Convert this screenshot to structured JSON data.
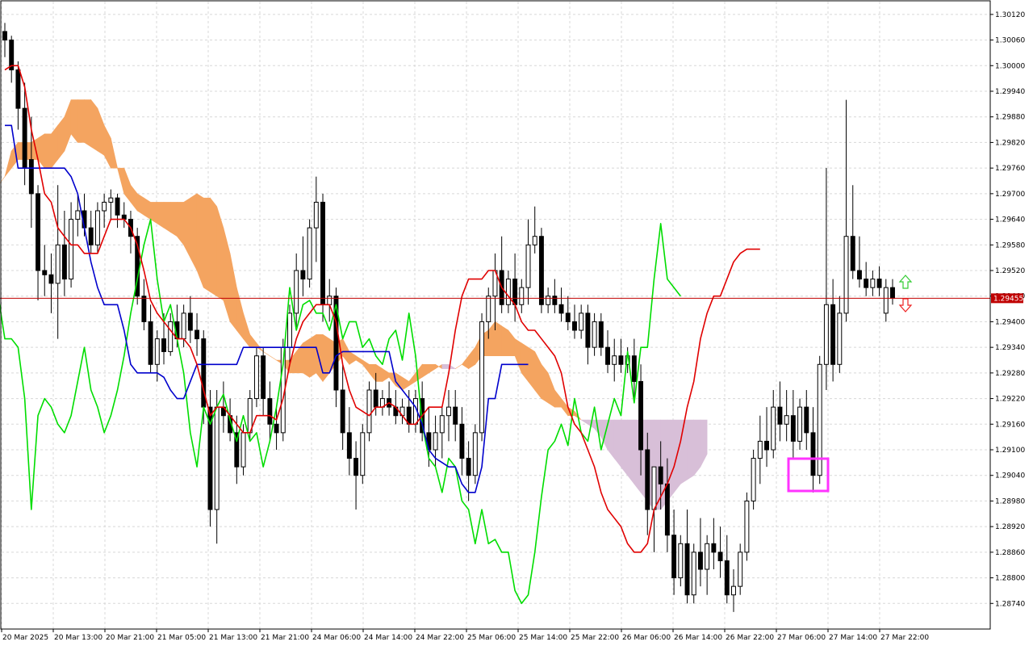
{
  "chart_data": {
    "type": "candlestick",
    "current_price": "1.29455",
    "ylim": [
      1.2868,
      1.3015
    ],
    "y_ticks": [
      "1.30120",
      "1.30060",
      "1.30000",
      "1.29940",
      "1.29880",
      "1.29820",
      "1.29760",
      "1.29700",
      "1.29640",
      "1.29580",
      "1.29520",
      "1.29460",
      "1.29400",
      "1.29340",
      "1.29280",
      "1.29220",
      "1.29160",
      "1.29100",
      "1.29040",
      "1.28980",
      "1.28920",
      "1.28860",
      "1.28800",
      "1.28740"
    ],
    "x_ticks": [
      "20 Mar 2025",
      "20 Mar 13:00",
      "20 Mar 21:00",
      "21 Mar 05:00",
      "21 Mar 13:00",
      "21 Mar 21:00",
      "24 Mar 06:00",
      "24 Mar 14:00",
      "24 Mar 22:00",
      "25 Mar 06:00",
      "25 Mar 14:00",
      "25 Mar 22:00",
      "26 Mar 06:00",
      "26 Mar 14:00",
      "26 Mar 22:00",
      "27 Mar 06:00",
      "27 Mar 14:00",
      "27 Mar 22:00"
    ],
    "colors": {
      "bull": "#ffffff",
      "bear": "#000000",
      "tenkan": "#e00000",
      "kijun": "#0000cc",
      "chikou": "#00dd00",
      "cloud_bull": "#f4a460",
      "cloud_bear": "#d8bfd8",
      "price_line": "#c00000",
      "highlight": "#ff33ff",
      "arrow_up": "#33cc33",
      "arrow_down": "#ee2222"
    },
    "candles": [
      [
        1.3008,
        1.301,
        1.3002,
        1.3006
      ],
      [
        1.3006,
        1.3007,
        1.2996,
        1.2999
      ],
      [
        1.2999,
        1.3001,
        1.2985,
        1.299
      ],
      [
        1.299,
        1.2996,
        1.2972,
        1.2976
      ],
      [
        1.2978,
        1.2988,
        1.2962,
        1.297
      ],
      [
        1.297,
        1.2972,
        1.2945,
        1.2952
      ],
      [
        1.2952,
        1.2958,
        1.2946,
        1.2951
      ],
      [
        1.2951,
        1.2956,
        1.2942,
        1.2949
      ],
      [
        1.2949,
        1.2972,
        1.2936,
        1.2958
      ],
      [
        1.2958,
        1.2966,
        1.2946,
        1.295
      ],
      [
        1.295,
        1.2968,
        1.2948,
        1.2964
      ],
      [
        1.2964,
        1.297,
        1.296,
        1.2966
      ],
      [
        1.2966,
        1.297,
        1.296,
        1.2962
      ],
      [
        1.2962,
        1.2966,
        1.2956,
        1.2958
      ],
      [
        1.2958,
        1.2968,
        1.2956,
        1.2966
      ],
      [
        1.2966,
        1.297,
        1.2962,
        1.2968
      ],
      [
        1.2968,
        1.2971,
        1.2964,
        1.2969
      ],
      [
        1.2969,
        1.297,
        1.2962,
        1.2965
      ],
      [
        1.2965,
        1.2968,
        1.2962,
        1.2964
      ],
      [
        1.2964,
        1.2966,
        1.2956,
        1.296
      ],
      [
        1.296,
        1.2962,
        1.2944,
        1.2946
      ],
      [
        1.2946,
        1.295,
        1.2938,
        1.294
      ],
      [
        1.294,
        1.2944,
        1.2928,
        1.293
      ],
      [
        1.293,
        1.2938,
        1.2926,
        1.2936
      ],
      [
        1.2936,
        1.2942,
        1.293,
        1.2933
      ],
      [
        1.2933,
        1.2942,
        1.2932,
        1.294
      ],
      [
        1.294,
        1.2944,
        1.2934,
        1.2936
      ],
      [
        1.2936,
        1.2944,
        1.2934,
        1.2942
      ],
      [
        1.2942,
        1.2946,
        1.2935,
        1.2938
      ],
      [
        1.2938,
        1.2942,
        1.2932,
        1.2936
      ],
      [
        1.2936,
        1.2938,
        1.2916,
        1.292
      ],
      [
        1.292,
        1.2924,
        1.2892,
        1.2896
      ],
      [
        1.2896,
        1.2924,
        1.2888,
        1.292
      ],
      [
        1.292,
        1.2926,
        1.2914,
        1.2918
      ],
      [
        1.2918,
        1.2922,
        1.2912,
        1.2914
      ],
      [
        1.2914,
        1.2918,
        1.2902,
        1.2906
      ],
      [
        1.2906,
        1.2916,
        1.2904,
        1.2914
      ],
      [
        1.2914,
        1.2924,
        1.2912,
        1.2922
      ],
      [
        1.2922,
        1.2934,
        1.292,
        1.2932
      ],
      [
        1.2932,
        1.2934,
        1.2918,
        1.2922
      ],
      [
        1.2922,
        1.2926,
        1.2912,
        1.2916
      ],
      [
        1.2916,
        1.292,
        1.291,
        1.2914
      ],
      [
        1.2914,
        1.2936,
        1.2912,
        1.2934
      ],
      [
        1.2934,
        1.2944,
        1.293,
        1.2942
      ],
      [
        1.2942,
        1.2956,
        1.2938,
        1.2952
      ],
      [
        1.2952,
        1.296,
        1.2946,
        1.295
      ],
      [
        1.295,
        1.2964,
        1.2948,
        1.2962
      ],
      [
        1.2962,
        1.2974,
        1.2954,
        1.2968
      ],
      [
        1.2968,
        1.297,
        1.294,
        1.2944
      ],
      [
        1.2944,
        1.295,
        1.294,
        1.2946
      ],
      [
        1.2946,
        1.2948,
        1.292,
        1.2924
      ],
      [
        1.2924,
        1.293,
        1.291,
        1.2914
      ],
      [
        1.2914,
        1.292,
        1.2904,
        1.2908
      ],
      [
        1.2908,
        1.2912,
        1.2896,
        1.2904
      ],
      [
        1.2904,
        1.2916,
        1.2902,
        1.2914
      ],
      [
        1.2914,
        1.2926,
        1.2912,
        1.2924
      ],
      [
        1.2924,
        1.2928,
        1.2918,
        1.292
      ],
      [
        1.292,
        1.2924,
        1.2918,
        1.2922
      ],
      [
        1.2922,
        1.2926,
        1.2918,
        1.292
      ],
      [
        1.292,
        1.2924,
        1.2916,
        1.2918
      ],
      [
        1.2918,
        1.2922,
        1.2916,
        1.292
      ],
      [
        1.292,
        1.2924,
        1.2914,
        1.2916
      ],
      [
        1.2916,
        1.2924,
        1.2914,
        1.2922
      ],
      [
        1.2922,
        1.2926,
        1.2912,
        1.2914
      ],
      [
        1.2914,
        1.292,
        1.2906,
        1.291
      ],
      [
        1.291,
        1.2918,
        1.2906,
        1.2914
      ],
      [
        1.2914,
        1.292,
        1.2908,
        1.2918
      ],
      [
        1.2918,
        1.2924,
        1.2912,
        1.292
      ],
      [
        1.292,
        1.2924,
        1.2912,
        1.2916
      ],
      [
        1.2916,
        1.292,
        1.2904,
        1.2908
      ],
      [
        1.2908,
        1.2912,
        1.2898,
        1.2904
      ],
      [
        1.2904,
        1.2916,
        1.2902,
        1.2914
      ],
      [
        1.2914,
        1.2942,
        1.2912,
        1.294
      ],
      [
        1.294,
        1.2948,
        1.2936,
        1.2946
      ],
      [
        1.2946,
        1.2956,
        1.2938,
        1.2952
      ],
      [
        1.2952,
        1.296,
        1.2942,
        1.2944
      ],
      [
        1.2944,
        1.2952,
        1.2942,
        1.295
      ],
      [
        1.295,
        1.2956,
        1.294,
        1.2944
      ],
      [
        1.2944,
        1.295,
        1.2942,
        1.2948
      ],
      [
        1.2948,
        1.2964,
        1.2944,
        1.2958
      ],
      [
        1.2958,
        1.2967,
        1.2956,
        1.296
      ],
      [
        1.296,
        1.2962,
        1.2942,
        1.2944
      ],
      [
        1.2944,
        1.2948,
        1.2942,
        1.2946
      ],
      [
        1.2946,
        1.295,
        1.2942,
        1.2944
      ],
      [
        1.2944,
        1.2948,
        1.294,
        1.2942
      ],
      [
        1.2942,
        1.2946,
        1.2938,
        1.294
      ],
      [
        1.294,
        1.2944,
        1.2936,
        1.2938
      ],
      [
        1.2938,
        1.2944,
        1.2936,
        1.2942
      ],
      [
        1.2942,
        1.2944,
        1.293,
        1.2934
      ],
      [
        1.2934,
        1.2942,
        1.2932,
        1.294
      ],
      [
        1.294,
        1.2942,
        1.2932,
        1.2934
      ],
      [
        1.2934,
        1.2938,
        1.2928,
        1.293
      ],
      [
        1.293,
        1.2936,
        1.2926,
        1.2932
      ],
      [
        1.2932,
        1.2936,
        1.2928,
        1.293
      ],
      [
        1.293,
        1.2934,
        1.2928,
        1.2932
      ],
      [
        1.2932,
        1.2936,
        1.2922,
        1.2926
      ],
      [
        1.2926,
        1.293,
        1.2904,
        1.291
      ],
      [
        1.291,
        1.2914,
        1.289,
        1.2896
      ],
      [
        1.2896,
        1.29,
        1.2886,
        1.2906
      ],
      [
        1.2906,
        1.2912,
        1.2896,
        1.2902
      ],
      [
        1.2902,
        1.2908,
        1.2886,
        1.289
      ],
      [
        1.289,
        1.2896,
        1.2876,
        1.288
      ],
      [
        1.288,
        1.289,
        1.2878,
        1.2888
      ],
      [
        1.2888,
        1.2896,
        1.2874,
        1.2876
      ],
      [
        1.2876,
        1.2888,
        1.2874,
        1.2886
      ],
      [
        1.2886,
        1.2894,
        1.2878,
        1.2882
      ],
      [
        1.2882,
        1.289,
        1.2876,
        1.2888
      ],
      [
        1.2888,
        1.2894,
        1.2882,
        1.2886
      ],
      [
        1.2886,
        1.2892,
        1.288,
        1.2884
      ],
      [
        1.2884,
        1.289,
        1.2874,
        1.2876
      ],
      [
        1.2876,
        1.2882,
        1.2872,
        1.2878
      ],
      [
        1.2878,
        1.2888,
        1.2876,
        1.2886
      ],
      [
        1.2886,
        1.29,
        1.2884,
        1.2898
      ],
      [
        1.2898,
        1.291,
        1.2896,
        1.2908
      ],
      [
        1.2908,
        1.2918,
        1.2902,
        1.2912
      ],
      [
        1.2912,
        1.292,
        1.2906,
        1.291
      ],
      [
        1.291,
        1.2924,
        1.2908,
        1.292
      ],
      [
        1.292,
        1.2926,
        1.2912,
        1.2916
      ],
      [
        1.2916,
        1.2924,
        1.2912,
        1.2918
      ],
      [
        1.2918,
        1.2924,
        1.2908,
        1.2912
      ],
      [
        1.2912,
        1.2922,
        1.291,
        1.292
      ],
      [
        1.292,
        1.2924,
        1.291,
        1.2914
      ],
      [
        1.2914,
        1.292,
        1.29,
        1.2904
      ],
      [
        1.2904,
        1.2932,
        1.2902,
        1.293
      ],
      [
        1.293,
        1.2976,
        1.2924,
        1.2944
      ],
      [
        1.2944,
        1.295,
        1.2926,
        1.293
      ],
      [
        1.293,
        1.2946,
        1.2928,
        1.2942
      ],
      [
        1.2942,
        1.2992,
        1.294,
        1.296
      ],
      [
        1.296,
        1.2972,
        1.295,
        1.2952
      ],
      [
        1.2952,
        1.296,
        1.2948,
        1.295
      ],
      [
        1.295,
        1.2954,
        1.2946,
        1.2948
      ],
      [
        1.2948,
        1.2952,
        1.2946,
        1.295
      ],
      [
        1.295,
        1.2953,
        1.2946,
        1.2948
      ],
      [
        1.2942,
        1.295,
        1.294,
        1.2948
      ],
      [
        1.2948,
        1.295,
        1.2944,
        1.29455
      ]
    ],
    "tenkan_sen": [
      1.2999,
      1.3,
      1.3,
      1.2995,
      1.2985,
      1.2978,
      1.297,
      1.2968,
      1.2962,
      1.296,
      1.2958,
      1.2958,
      1.2956,
      1.2956,
      1.2956,
      1.296,
      1.2964,
      1.2964,
      1.2964,
      1.2962,
      1.2958,
      1.2952,
      1.2945,
      1.2942,
      1.294,
      1.2938,
      1.2936,
      1.2936,
      1.2934,
      1.293,
      1.2924,
      1.2918,
      1.292,
      1.292,
      1.2918,
      1.2916,
      1.2914,
      1.2914,
      1.2918,
      1.2918,
      1.2918,
      1.2917,
      1.2922,
      1.293,
      1.2936,
      1.294,
      1.2942,
      1.2944,
      1.2944,
      1.2944,
      1.294,
      1.293,
      1.2924,
      1.292,
      1.2919,
      1.2918,
      1.292,
      1.292,
      1.2921,
      1.292,
      1.2918,
      1.2916,
      1.2916,
      1.2918,
      1.292,
      1.292,
      1.292,
      1.2928,
      1.2938,
      1.2946,
      1.295,
      1.295,
      1.295,
      1.2952,
      1.2952,
      1.2948,
      1.2946,
      1.2944,
      1.294,
      1.2938,
      1.2938,
      1.2936,
      1.2934,
      1.2932,
      1.2928,
      1.292,
      1.2916,
      1.2914,
      1.291,
      1.2906,
      1.29,
      1.2896,
      1.2894,
      1.2892,
      1.2888,
      1.2886,
      1.2886,
      1.2888,
      1.2896,
      1.2899,
      1.2902,
      1.2906,
      1.2912,
      1.292,
      1.2926,
      1.2936,
      1.2942,
      1.2946,
      1.2946,
      1.295,
      1.2954,
      1.2956,
      1.2957,
      1.2957,
      1.2957
    ],
    "kijun_sen": [
      1.2986,
      1.2986,
      1.2976,
      1.2976,
      1.2976,
      1.2976,
      1.2976,
      1.2976,
      1.2976,
      1.2976,
      1.2974,
      1.297,
      1.2962,
      1.2954,
      1.2948,
      1.2944,
      1.2944,
      1.2944,
      1.2938,
      1.293,
      1.2928,
      1.2928,
      1.2928,
      1.2928,
      1.2927,
      1.2924,
      1.2922,
      1.2922,
      1.2926,
      1.293,
      1.293,
      1.293,
      1.293,
      1.293,
      1.293,
      1.293,
      1.2934,
      1.2934,
      1.2934,
      1.2934,
      1.2934,
      1.2934,
      1.2934,
      1.2934,
      1.2934,
      1.2934,
      1.2934,
      1.2934,
      1.2928,
      1.2928,
      1.2932,
      1.2933,
      1.2933,
      1.2933,
      1.2933,
      1.2933,
      1.2933,
      1.2933,
      1.2933,
      1.2926,
      1.2924,
      1.2922,
      1.292,
      1.2916,
      1.291,
      1.2908,
      1.2907,
      1.2906,
      1.2906,
      1.2902,
      1.29,
      1.29,
      1.2906,
      1.2922,
      1.2922,
      1.293,
      1.293,
      1.293,
      1.293,
      1.293
    ],
    "chikou_span": [
      1.293,
      1.2936,
      1.2938,
      1.2935,
      1.2942,
      1.2936,
      1.2938,
      1.2946,
      1.2936,
      1.2936,
      1.2934,
      1.2922,
      1.2896,
      1.2918,
      1.2922,
      1.292,
      1.2916,
      1.2914,
      1.2918,
      1.2926,
      1.2934,
      1.2924,
      1.292,
      1.2914,
      1.2918,
      1.2924,
      1.2932,
      1.2942,
      1.295,
      1.2958,
      1.2964,
      1.295,
      1.294,
      1.2944,
      1.2936,
      1.2928,
      1.2914,
      1.2906,
      1.292,
      1.2916,
      1.292,
      1.2923,
      1.2917,
      1.2912,
      1.2918,
      1.2912,
      1.2914,
      1.2906,
      1.2912,
      1.292,
      1.293,
      1.2948,
      1.2938,
      1.2944,
      1.2945,
      1.2942,
      1.2942,
      1.2938,
      1.2944,
      1.2936,
      1.294,
      1.294,
      1.2934,
      1.2936,
      1.2932,
      1.293,
      1.2936,
      1.2938,
      1.2931,
      1.2942,
      1.2932,
      1.2916,
      1.2908,
      1.2906,
      1.29,
      1.2908,
      1.2906,
      1.2898,
      1.2896,
      1.2888,
      1.2896,
      1.2888,
      1.2889,
      1.2886,
      1.2886,
      1.2877,
      1.2874,
      1.2876,
      1.2886,
      1.2899,
      1.291,
      1.2912,
      1.2916,
      1.2911,
      1.2922,
      1.2914,
      1.2912,
      1.292,
      1.291,
      1.2916,
      1.2922,
      1.2918,
      1.2933,
      1.2921,
      1.2934,
      1.2934,
      1.295,
      1.2963,
      1.295,
      1.2948,
      1.2946
    ],
    "senkou_a": [
      1.298,
      1.2976,
      1.2974,
      1.2972,
      1.2974,
      1.298,
      1.2982,
      1.2982,
      1.2982,
      1.2983,
      1.2984,
      1.2984,
      1.2986,
      1.2988,
      1.2992,
      1.2992,
      1.2992,
      1.2992,
      1.299,
      1.2986,
      1.2983,
      1.2976,
      1.2976,
      1.2972,
      1.297,
      1.2969,
      1.2968,
      1.2968,
      1.2968,
      1.2968,
      1.2968,
      1.2968,
      1.2969,
      1.297,
      1.2969,
      1.2969,
      1.2967,
      1.2962,
      1.2956,
      1.2948,
      1.2942,
      1.2937,
      1.2935,
      1.2933,
      1.2932,
      1.2931,
      1.2931,
      1.2931,
      1.2933,
      1.2935,
      1.2936,
      1.2937,
      1.2937,
      1.2936,
      1.2935,
      1.2936,
      1.2933,
      1.2932,
      1.2931,
      1.293,
      1.293,
      1.2929,
      1.2928,
      1.2928,
      1.2927,
      1.2926,
      1.2928,
      1.293,
      1.293,
      1.293,
      1.2929,
      1.2929,
      1.2929,
      1.293,
      1.2932,
      1.2934,
      1.2937,
      1.2938,
      1.294,
      1.2939,
      1.2938,
      1.2936,
      1.2935,
      1.2934,
      1.2933,
      1.293,
      1.2928,
      1.2924,
      1.2922,
      1.292,
      1.2919,
      1.2917,
      1.2916,
      1.2915,
      1.2913,
      1.291,
      1.2908,
      1.2906,
      1.2904,
      1.2902,
      1.29,
      1.2898,
      1.2896,
      1.2896,
      1.2898,
      1.29,
      1.2902,
      1.2903,
      1.2904,
      1.2906,
      1.2909
    ],
    "senkou_b": [
      1.2966,
      1.2968,
      1.297,
      1.2972,
      1.2974,
      1.2976,
      1.2978,
      1.2978,
      1.2978,
      1.2978,
      1.2976,
      1.2976,
      1.2978,
      1.298,
      1.2984,
      1.2982,
      1.2982,
      1.2981,
      1.298,
      1.2979,
      1.2976,
      1.2976,
      1.297,
      1.2968,
      1.2966,
      1.2965,
      1.2964,
      1.2963,
      1.2962,
      1.2961,
      1.296,
      1.2958,
      1.2955,
      1.2952,
      1.2948,
      1.2947,
      1.2946,
      1.2945,
      1.294,
      1.2938,
      1.2936,
      1.2934,
      1.2934,
      1.2933,
      1.2932,
      1.2931,
      1.293,
      1.2928,
      1.2928,
      1.2928,
      1.2927,
      1.2928,
      1.2926,
      1.2928,
      1.293,
      1.2932,
      1.293,
      1.2931,
      1.293,
      1.2928,
      1.2926,
      1.2926,
      1.2927,
      1.2925,
      1.2924,
      1.2925,
      1.2926,
      1.2927,
      1.2928,
      1.2929,
      1.293,
      1.293,
      1.2929,
      1.293,
      1.2929,
      1.293,
      1.2932,
      1.2932,
      1.2932,
      1.2932,
      1.2932,
      1.2932,
      1.2928,
      1.2926,
      1.2924,
      1.2922,
      1.2921,
      1.292,
      1.292,
      1.2918,
      1.2918,
      1.2917,
      1.2917,
      1.2917,
      1.2917,
      1.2917,
      1.2917,
      1.2917,
      1.2917,
      1.2917,
      1.2917,
      1.2917,
      1.2917,
      1.2917,
      1.2917,
      1.2917,
      1.2917,
      1.2917,
      1.2917,
      1.2917,
      1.2917
    ]
  }
}
